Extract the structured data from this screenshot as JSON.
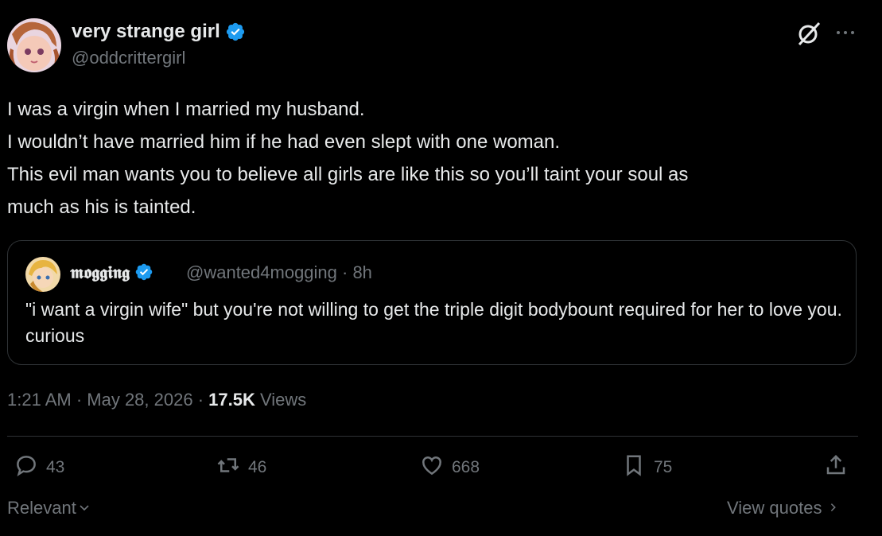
{
  "author": {
    "display_name": "very strange girl",
    "handle": "@oddcrittergirl"
  },
  "icons": {
    "grok": "grok-icon",
    "more": "more-icon",
    "verified": "verified-badge-icon",
    "reply": "reply-icon",
    "retweet": "retweet-icon",
    "like": "like-icon",
    "bookmark": "bookmark-icon",
    "share": "share-icon"
  },
  "colors": {
    "background": "#000000",
    "text": "#e7e9ea",
    "secondary": "#71767b",
    "verified": "#1d9bf0",
    "border": "#2f3336"
  },
  "post": {
    "lines": [
      "I was a virgin when I married my husband.",
      "I wouldn’t have married him if he had even slept with one woman.",
      "This evil man wants you to believe all girls are like this so you’ll taint your soul as",
      "much as his is tainted."
    ]
  },
  "quote": {
    "display_name": "𝖒𝖔𝖌𝖌𝖎𝖓𝖌",
    "handle_time": "@wanted4mogging · 8h",
    "text": "\"i want a virgin wife\" but you're not willing to get the triple digit bodybount required for her to love you. curious"
  },
  "meta": {
    "time_date": "1:21 AM · May 28, 2026 · ",
    "views_count": "17.5K",
    "views_label": "Views"
  },
  "actions": {
    "replies": "43",
    "reposts": "46",
    "likes": "668",
    "bookmarks": "75"
  },
  "footer": {
    "sort_label": "Relevant",
    "view_quotes": "View quotes"
  }
}
